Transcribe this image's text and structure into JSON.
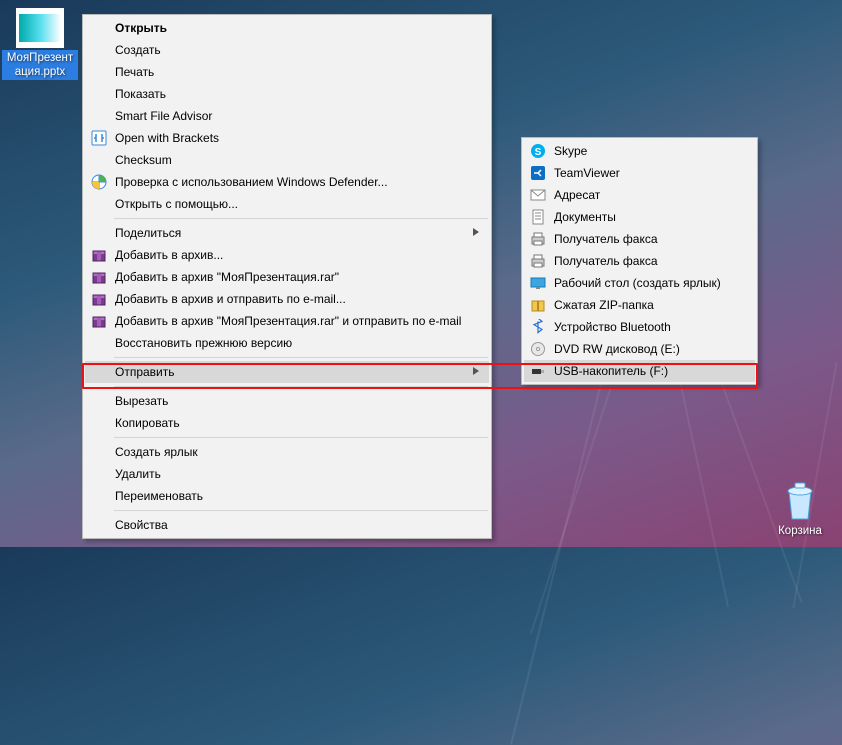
{
  "desktop": {
    "file": {
      "label": "МояПрезент\nация.pptx"
    },
    "bin": {
      "label": "Корзина"
    }
  },
  "menu1": {
    "items": [
      {
        "label": "Открыть",
        "bold": true
      },
      {
        "label": "Создать"
      },
      {
        "label": "Печать"
      },
      {
        "label": "Показать"
      },
      {
        "label": "Smart File Advisor"
      },
      {
        "label": "Open with Brackets",
        "icon": "brackets"
      },
      {
        "label": "Checksum"
      },
      {
        "label": "Проверка с использованием Windows Defender...",
        "icon": "defender"
      },
      {
        "label": "Открыть с помощью..."
      },
      {
        "sep": true
      },
      {
        "label": "Поделиться",
        "sub": true
      },
      {
        "label": "Добавить в архив...",
        "icon": "rar"
      },
      {
        "label": "Добавить в архив \"МояПрезентация.rar\"",
        "icon": "rar"
      },
      {
        "label": "Добавить в архив и отправить по e-mail...",
        "icon": "rar"
      },
      {
        "label": "Добавить в архив \"МояПрезентация.rar\" и отправить по e-mail",
        "icon": "rar"
      },
      {
        "label": "Восстановить прежнюю версию"
      },
      {
        "sep": true
      },
      {
        "label": "Отправить",
        "sub": true,
        "hover": true
      },
      {
        "sep": true
      },
      {
        "label": "Вырезать"
      },
      {
        "label": "Копировать"
      },
      {
        "sep": true
      },
      {
        "label": "Создать ярлык"
      },
      {
        "label": "Удалить"
      },
      {
        "label": "Переименовать"
      },
      {
        "sep": true
      },
      {
        "label": "Свойства"
      }
    ]
  },
  "menu2": {
    "items": [
      {
        "label": "Skype",
        "icon": "skype"
      },
      {
        "label": "TeamViewer",
        "icon": "tv"
      },
      {
        "label": "Адресат",
        "icon": "mail"
      },
      {
        "label": "Документы",
        "icon": "docs"
      },
      {
        "label": "Получатель факса",
        "icon": "fax"
      },
      {
        "label": "Получатель факса",
        "icon": "fax"
      },
      {
        "label": "Рабочий стол (создать ярлык)",
        "icon": "desk"
      },
      {
        "label": "Сжатая ZIP-папка",
        "icon": "zip"
      },
      {
        "label": "Устройство Bluetooth",
        "icon": "bt"
      },
      {
        "label": "DVD RW дисковод (E:)",
        "icon": "dvd"
      },
      {
        "label": "USB-накопитель (F:)",
        "icon": "usb",
        "hover": true
      }
    ]
  }
}
